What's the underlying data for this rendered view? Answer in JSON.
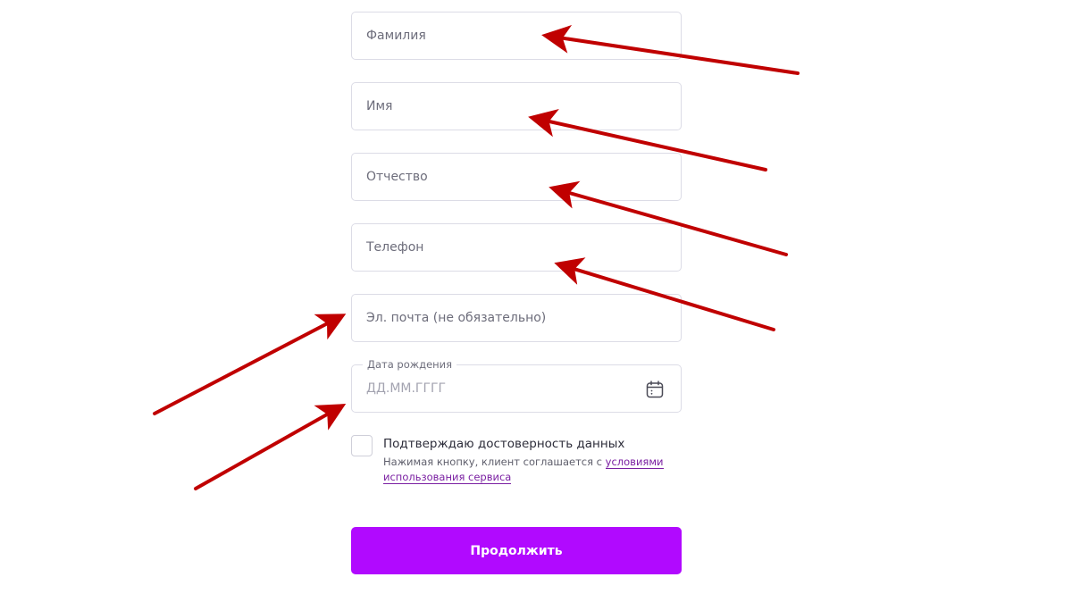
{
  "form": {
    "last_name": {
      "placeholder": "Фамилия",
      "value": ""
    },
    "first_name": {
      "placeholder": "Имя",
      "value": ""
    },
    "middle_name": {
      "placeholder": "Отчество",
      "value": ""
    },
    "phone": {
      "placeholder": "Телефон",
      "value": ""
    },
    "email": {
      "placeholder": "Эл. почта (не обязательно)",
      "value": ""
    },
    "birth_date": {
      "label": "Дата рождения",
      "placeholder": "ДД.ММ.ГГГГ",
      "value": "",
      "icon": "calendar-icon"
    },
    "consent": {
      "checked": false,
      "title": "Подтверждаю достоверность данных",
      "note_prefix": "Нажимая кнопку, клиент соглашается с ",
      "terms_link": "условиями использования сервиса"
    },
    "submit_label": "Продолжить"
  },
  "colors": {
    "accent": "#b109ff",
    "link": "#7a1fa2",
    "annotation_arrow": "#c00000"
  }
}
